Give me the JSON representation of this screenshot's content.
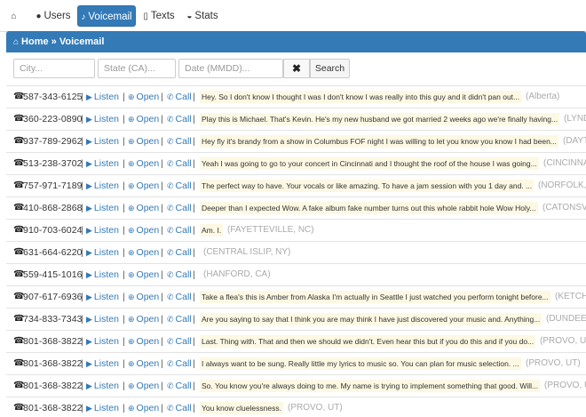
{
  "nav": {
    "home_icon": "home-icon",
    "users": "Users",
    "voicemail": "Voicemail",
    "texts": "Texts",
    "stats": "Stats"
  },
  "breadcrumb": {
    "home": "Home",
    "separator": "»",
    "current": "Voicemail"
  },
  "filters": {
    "city_placeholder": "City...",
    "state_placeholder": "State (CA)...",
    "date_placeholder": "Date (MMDD)...",
    "clear_label": "✖",
    "search_label": "Search"
  },
  "row_labels": {
    "listen": "Listen",
    "open": "Open",
    "call": "Call",
    "separator": "|"
  },
  "colors": {
    "primary": "#337ab7",
    "highlight": "#fcf8e3",
    "muted": "#aaaaaa"
  },
  "voicemails": [
    {
      "phone": "587-343-6125",
      "transcript": "Hey. So I don't know I thought I was I don't know I was really into this guy and it didn't pan out...",
      "location": "(Alberta)"
    },
    {
      "phone": "360-223-0890",
      "transcript": "Play this is Michael. That's Kevin. He's my new husband we got married 2 weeks ago we're finally having...",
      "location": "(LYNDEN, WA)"
    },
    {
      "phone": "937-789-2962",
      "transcript": "Hey fly it's brandy from a show in Columbus FOF night I was willing to let you know you know I had been...",
      "location": "(DAYTON, OH)"
    },
    {
      "phone": "513-238-3702",
      "transcript": "Yeah I was going to go to your concert in Cincinnati and I thought the roof of the house I was going...",
      "location": "(CINCINNATI, OH)"
    },
    {
      "phone": "757-971-7189",
      "transcript": "The perfect way to have. Your vocals or like amazing. To have a jam session with you 1 day and. ...",
      "location": "(NORFOLK, VA)"
    },
    {
      "phone": "410-868-2868",
      "transcript": "Deeper than I expected Wow. A fake album fake number turns out this whole rabbit hole Wow Holy...",
      "location": "(CATONSVILLE, MD)"
    },
    {
      "phone": "910-703-6024",
      "transcript": "Am. I.",
      "location": "(FAYETTEVILLE, NC)"
    },
    {
      "phone": "631-664-6220",
      "transcript": "",
      "location": "(CENTRAL ISLIP, NY)"
    },
    {
      "phone": "559-415-1016",
      "transcript": "",
      "location": "(HANFORD, CA)"
    },
    {
      "phone": "907-617-6936",
      "transcript": "Take a flea's this is Amber from Alaska I'm actually in Seattle I just watched you perform tonight before...",
      "location": "(KETCHIKAN, AK)"
    },
    {
      "phone": "734-833-7343",
      "transcript": "Are you saying to say that I think you are may think I have just discovered your music and. Anything...",
      "location": "(DUNDEE, MI)"
    },
    {
      "phone": "801-368-3822",
      "transcript": "Last. Thing with. That and then we should we didn't. Even hear this but if you do this and if you do...",
      "location": "(PROVO, UT)"
    },
    {
      "phone": "801-368-3822",
      "transcript": "I always want to be sung. Really little my lyrics to music so. You can plan for music selection. ...",
      "location": "(PROVO, UT)"
    },
    {
      "phone": "801-368-3822",
      "transcript": "So. You know you're always doing to me. My name is trying to implement something that good. Will...",
      "location": "(PROVO, UT)"
    },
    {
      "phone": "801-368-3822",
      "transcript": "You know cluelessness.",
      "location": "(PROVO, UT)"
    }
  ]
}
